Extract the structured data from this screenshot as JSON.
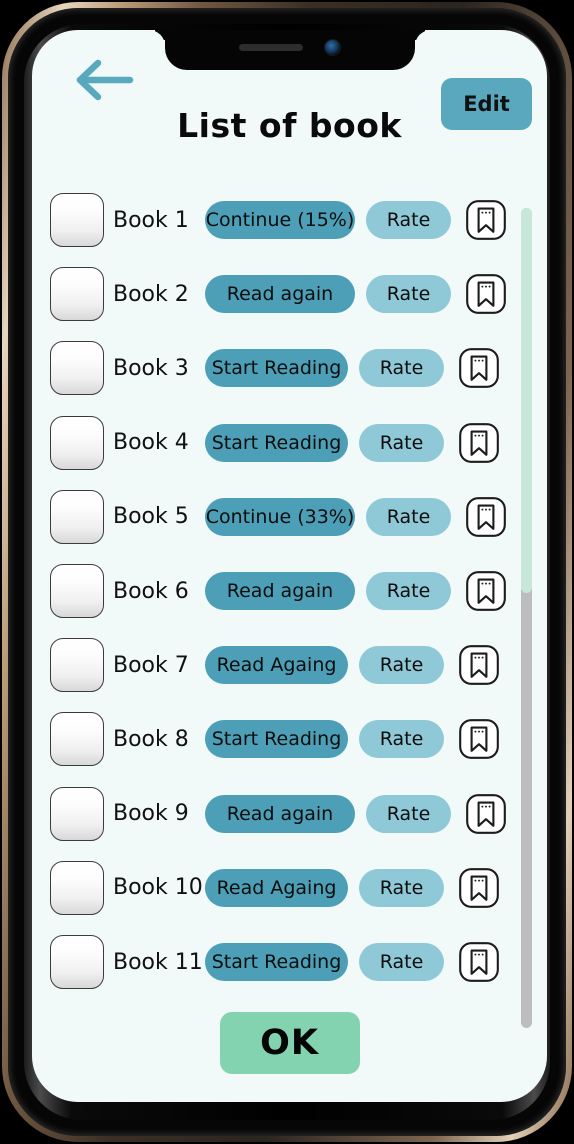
{
  "header": {
    "back_icon": "arrow-left-icon",
    "title": "List of book",
    "edit_label": "Edit"
  },
  "colors": {
    "screen_background": "#f1faf8",
    "accent_teal": "#5aa8bd",
    "action_button": "#4c9fb6",
    "rate_button": "#8fc9d8",
    "ok_button": "#84d3b0",
    "scrollbar_thumb": "#c7e7d8",
    "scrollbar_track": "#bdbdbd"
  },
  "list": {
    "rate_label": "Rate",
    "bookmark_icon": "bookmark-icon",
    "rows": [
      {
        "label": "Book 1",
        "action": "Continue (15%)",
        "action_width": 150,
        "rate": "Rate"
      },
      {
        "label": "Book 2",
        "action": "Read again",
        "action_width": 150,
        "rate": "Rate"
      },
      {
        "label": "Book 3",
        "action": "Start Reading",
        "action_width": 143,
        "rate": "Rate"
      },
      {
        "label": "Book 4",
        "action": "Start Reading",
        "action_width": 143,
        "rate": "Rate"
      },
      {
        "label": "Book 5",
        "action": "Continue (33%)",
        "action_width": 150,
        "rate": "Rate"
      },
      {
        "label": "Book 6",
        "action": "Read again",
        "action_width": 150,
        "rate": "Rate"
      },
      {
        "label": "Book 7",
        "action": "Read Againg",
        "action_width": 143,
        "rate": "Rate"
      },
      {
        "label": "Book 8",
        "action": "Start Reading",
        "action_width": 143,
        "rate": "Rate"
      },
      {
        "label": "Book 9",
        "action": "Read again",
        "action_width": 150,
        "rate": "Rate"
      },
      {
        "label": "Book 10",
        "action": "Read Againg",
        "action_width": 143,
        "rate": "Rate"
      },
      {
        "label": "Book 11",
        "action": "Start Reading",
        "action_width": 143,
        "rate": "Rate"
      }
    ]
  },
  "scrollbar": {
    "thumb_percent": 47
  },
  "footer": {
    "ok_label": "OK"
  }
}
